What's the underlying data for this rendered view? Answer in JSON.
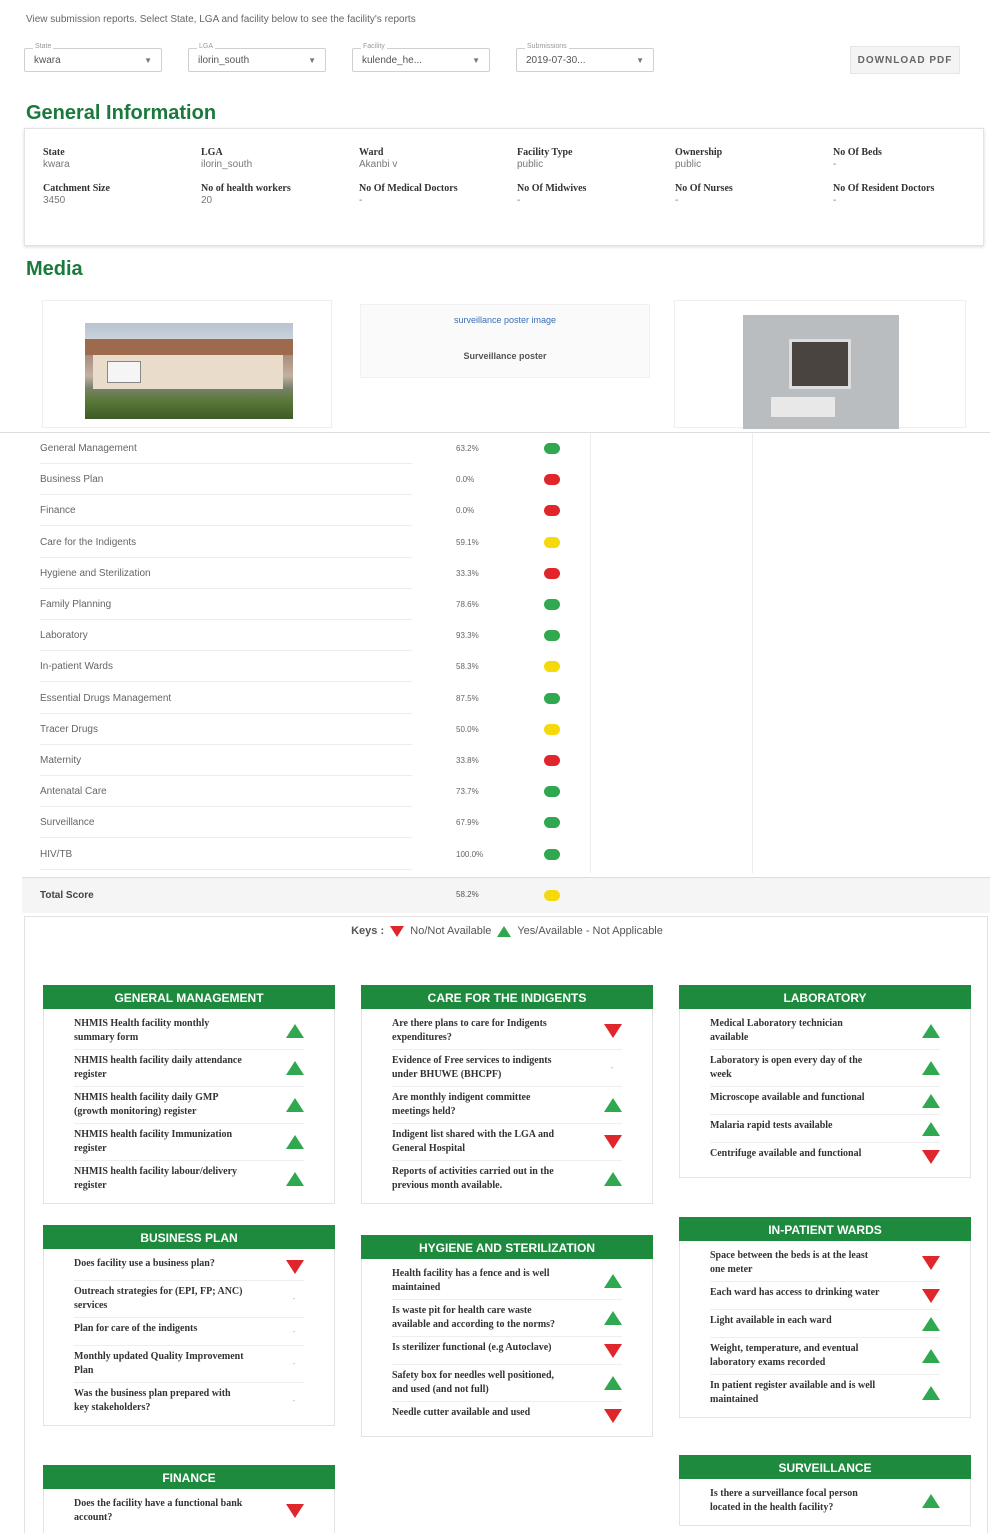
{
  "instruction": "View submission reports. Select State, LGA and facility below to see the facility's reports",
  "filters": [
    {
      "label": "State",
      "value": "kwara"
    },
    {
      "label": "LGA",
      "value": "ilorin_south"
    },
    {
      "label": "Facility",
      "value": "kulende_he..."
    },
    {
      "label": "Submissions",
      "value": "2019-07-30..."
    }
  ],
  "download_label": "DOWNLOAD PDF",
  "general_info": {
    "title": "General Information",
    "fields": [
      {
        "label": "State",
        "value": "kwara"
      },
      {
        "label": "LGA",
        "value": "ilorin_south"
      },
      {
        "label": "Ward",
        "value": "Akanbi v"
      },
      {
        "label": "Facility Type",
        "value": "public"
      },
      {
        "label": "Ownership",
        "value": "public"
      },
      {
        "label": "No Of Beds",
        "value": "-"
      },
      {
        "label": "Catchment Size",
        "value": "3450"
      },
      {
        "label": "No of health workers",
        "value": "20"
      },
      {
        "label": "No Of Medical Doctors",
        "value": "-"
      },
      {
        "label": "No Of Midwives",
        "value": "-"
      },
      {
        "label": "No Of Nurses",
        "value": "-"
      },
      {
        "label": "No Of Resident Doctors",
        "value": "-"
      }
    ]
  },
  "media": {
    "title": "Media",
    "poster_alt": "surveillance poster image",
    "poster_caption": "Surveillance poster"
  },
  "scores": {
    "colors": {
      "green": "#2fa84f",
      "red": "#e0262b",
      "yellow": "#f5d90a"
    },
    "rows": [
      {
        "name": "General Management",
        "pct": "63.2%",
        "status": "green"
      },
      {
        "name": "Business Plan",
        "pct": "0.0%",
        "status": "red"
      },
      {
        "name": "Finance",
        "pct": "0.0%",
        "status": "red"
      },
      {
        "name": "Care for the Indigents",
        "pct": "59.1%",
        "status": "yellow"
      },
      {
        "name": "Hygiene and Sterilization",
        "pct": "33.3%",
        "status": "red"
      },
      {
        "name": "Family Planning",
        "pct": "78.6%",
        "status": "green"
      },
      {
        "name": "Laboratory",
        "pct": "93.3%",
        "status": "green"
      },
      {
        "name": "In-patient Wards",
        "pct": "58.3%",
        "status": "yellow"
      },
      {
        "name": "Essential Drugs Management",
        "pct": "87.5%",
        "status": "green"
      },
      {
        "name": "Tracer Drugs",
        "pct": "50.0%",
        "status": "yellow"
      },
      {
        "name": "Maternity",
        "pct": "33.8%",
        "status": "red"
      },
      {
        "name": "Antenatal Care",
        "pct": "73.7%",
        "status": "green"
      },
      {
        "name": "Surveillance",
        "pct": "67.9%",
        "status": "green"
      },
      {
        "name": "HIV/TB",
        "pct": "100.0%",
        "status": "green"
      }
    ],
    "total": {
      "name": "Total Score",
      "pct": "58.2%",
      "status": "yellow"
    }
  },
  "keys": {
    "label": "Keys :",
    "no": "No/Not Available",
    "yes": "Yes/Available",
    "na": "- Not Applicable"
  },
  "panels": [
    {
      "title": "General Management",
      "items": [
        {
          "q": "NHMIS Health facility monthly summary form",
          "a": "yes"
        },
        {
          "q": "NHMIS health facility daily attendance register",
          "a": "yes"
        },
        {
          "q": "NHMIS health facility daily GMP (growth monitoring) register",
          "a": "yes"
        },
        {
          "q": "NHMIS health facility Immunization register",
          "a": "yes"
        },
        {
          "q": "NHMIS health facility labour/delivery register",
          "a": "yes"
        }
      ]
    },
    {
      "title": "Business Plan",
      "items": [
        {
          "q": "Does facility use a business plan?",
          "a": "no"
        },
        {
          "q": "Outreach strategies for (EPI, FP; ANC) services",
          "a": "na"
        },
        {
          "q": "Plan for care of the indigents",
          "a": "na"
        },
        {
          "q": "Monthly updated Quality Improvement Plan",
          "a": "na"
        },
        {
          "q": "Was the business plan prepared with key stakeholders?",
          "a": "na"
        }
      ]
    },
    {
      "title": "Finance",
      "items": [
        {
          "q": "Does the facility have a functional bank account?",
          "a": "no"
        }
      ]
    },
    {
      "title": "Care for the Indigents",
      "items": [
        {
          "q": "Are there plans to care for Indigents expenditures?",
          "a": "no"
        },
        {
          "q": "Evidence of Free services to indigents under BHUWE (BHCPF)",
          "a": "na"
        },
        {
          "q": "Are monthly indigent committee meetings held?",
          "a": "yes"
        },
        {
          "q": "Indigent list shared with the LGA and General Hospital",
          "a": "no"
        },
        {
          "q": "Reports of activities carried out in the previous month available.",
          "a": "yes"
        }
      ]
    },
    {
      "title": "Hygiene and Sterilization",
      "items": [
        {
          "q": "Health facility has a fence and is well maintained",
          "a": "yes"
        },
        {
          "q": "Is waste pit for health care waste available and according to the norms?",
          "a": "yes"
        },
        {
          "q": "Is sterilizer functional (e.g Autoclave)",
          "a": "no"
        },
        {
          "q": "Safety box for needles well positioned, and used (and not full)",
          "a": "yes"
        },
        {
          "q": "Needle cutter available and used",
          "a": "no"
        }
      ]
    },
    {
      "title": "Laboratory",
      "items": [
        {
          "q": "Medical Laboratory technician available",
          "a": "yes"
        },
        {
          "q": "Laboratory is open every day of the week",
          "a": "yes"
        },
        {
          "q": "Microscope available and functional",
          "a": "yes"
        },
        {
          "q": "Malaria rapid tests available",
          "a": "yes"
        },
        {
          "q": "Centrifuge available and functional",
          "a": "no"
        }
      ]
    },
    {
      "title": "In-patient Wards",
      "items": [
        {
          "q": "Space between the beds is at the least one meter",
          "a": "no"
        },
        {
          "q": "Each ward has access to drinking water",
          "a": "no"
        },
        {
          "q": "Light available in each ward",
          "a": "yes"
        },
        {
          "q": "Weight, temperature, and eventual laboratory exams recorded",
          "a": "yes"
        },
        {
          "q": "In patient register available and is well maintained",
          "a": "yes"
        }
      ]
    },
    {
      "title": "Surveillance",
      "items": [
        {
          "q": "Is there a surveillance focal person located in the health facility?",
          "a": "yes"
        }
      ]
    }
  ]
}
